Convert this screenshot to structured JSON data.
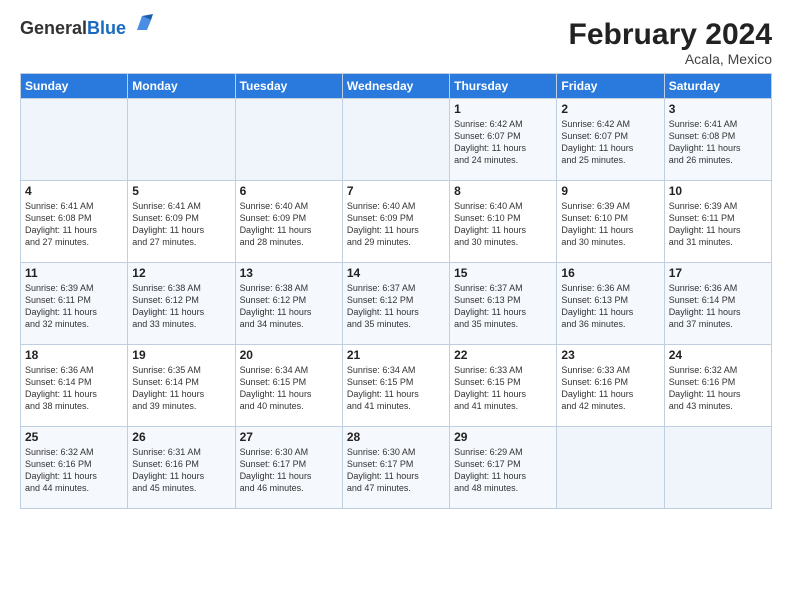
{
  "logo": {
    "general": "General",
    "blue": "Blue"
  },
  "title": "February 2024",
  "location": "Acala, Mexico",
  "days_of_week": [
    "Sunday",
    "Monday",
    "Tuesday",
    "Wednesday",
    "Thursday",
    "Friday",
    "Saturday"
  ],
  "weeks": [
    [
      {
        "day": "",
        "info": ""
      },
      {
        "day": "",
        "info": ""
      },
      {
        "day": "",
        "info": ""
      },
      {
        "day": "",
        "info": ""
      },
      {
        "day": "1",
        "info": "Sunrise: 6:42 AM\nSunset: 6:07 PM\nDaylight: 11 hours\nand 24 minutes."
      },
      {
        "day": "2",
        "info": "Sunrise: 6:42 AM\nSunset: 6:07 PM\nDaylight: 11 hours\nand 25 minutes."
      },
      {
        "day": "3",
        "info": "Sunrise: 6:41 AM\nSunset: 6:08 PM\nDaylight: 11 hours\nand 26 minutes."
      }
    ],
    [
      {
        "day": "4",
        "info": "Sunrise: 6:41 AM\nSunset: 6:08 PM\nDaylight: 11 hours\nand 27 minutes."
      },
      {
        "day": "5",
        "info": "Sunrise: 6:41 AM\nSunset: 6:09 PM\nDaylight: 11 hours\nand 27 minutes."
      },
      {
        "day": "6",
        "info": "Sunrise: 6:40 AM\nSunset: 6:09 PM\nDaylight: 11 hours\nand 28 minutes."
      },
      {
        "day": "7",
        "info": "Sunrise: 6:40 AM\nSunset: 6:09 PM\nDaylight: 11 hours\nand 29 minutes."
      },
      {
        "day": "8",
        "info": "Sunrise: 6:40 AM\nSunset: 6:10 PM\nDaylight: 11 hours\nand 30 minutes."
      },
      {
        "day": "9",
        "info": "Sunrise: 6:39 AM\nSunset: 6:10 PM\nDaylight: 11 hours\nand 30 minutes."
      },
      {
        "day": "10",
        "info": "Sunrise: 6:39 AM\nSunset: 6:11 PM\nDaylight: 11 hours\nand 31 minutes."
      }
    ],
    [
      {
        "day": "11",
        "info": "Sunrise: 6:39 AM\nSunset: 6:11 PM\nDaylight: 11 hours\nand 32 minutes."
      },
      {
        "day": "12",
        "info": "Sunrise: 6:38 AM\nSunset: 6:12 PM\nDaylight: 11 hours\nand 33 minutes."
      },
      {
        "day": "13",
        "info": "Sunrise: 6:38 AM\nSunset: 6:12 PM\nDaylight: 11 hours\nand 34 minutes."
      },
      {
        "day": "14",
        "info": "Sunrise: 6:37 AM\nSunset: 6:12 PM\nDaylight: 11 hours\nand 35 minutes."
      },
      {
        "day": "15",
        "info": "Sunrise: 6:37 AM\nSunset: 6:13 PM\nDaylight: 11 hours\nand 35 minutes."
      },
      {
        "day": "16",
        "info": "Sunrise: 6:36 AM\nSunset: 6:13 PM\nDaylight: 11 hours\nand 36 minutes."
      },
      {
        "day": "17",
        "info": "Sunrise: 6:36 AM\nSunset: 6:14 PM\nDaylight: 11 hours\nand 37 minutes."
      }
    ],
    [
      {
        "day": "18",
        "info": "Sunrise: 6:36 AM\nSunset: 6:14 PM\nDaylight: 11 hours\nand 38 minutes."
      },
      {
        "day": "19",
        "info": "Sunrise: 6:35 AM\nSunset: 6:14 PM\nDaylight: 11 hours\nand 39 minutes."
      },
      {
        "day": "20",
        "info": "Sunrise: 6:34 AM\nSunset: 6:15 PM\nDaylight: 11 hours\nand 40 minutes."
      },
      {
        "day": "21",
        "info": "Sunrise: 6:34 AM\nSunset: 6:15 PM\nDaylight: 11 hours\nand 41 minutes."
      },
      {
        "day": "22",
        "info": "Sunrise: 6:33 AM\nSunset: 6:15 PM\nDaylight: 11 hours\nand 41 minutes."
      },
      {
        "day": "23",
        "info": "Sunrise: 6:33 AM\nSunset: 6:16 PM\nDaylight: 11 hours\nand 42 minutes."
      },
      {
        "day": "24",
        "info": "Sunrise: 6:32 AM\nSunset: 6:16 PM\nDaylight: 11 hours\nand 43 minutes."
      }
    ],
    [
      {
        "day": "25",
        "info": "Sunrise: 6:32 AM\nSunset: 6:16 PM\nDaylight: 11 hours\nand 44 minutes."
      },
      {
        "day": "26",
        "info": "Sunrise: 6:31 AM\nSunset: 6:16 PM\nDaylight: 11 hours\nand 45 minutes."
      },
      {
        "day": "27",
        "info": "Sunrise: 6:30 AM\nSunset: 6:17 PM\nDaylight: 11 hours\nand 46 minutes."
      },
      {
        "day": "28",
        "info": "Sunrise: 6:30 AM\nSunset: 6:17 PM\nDaylight: 11 hours\nand 47 minutes."
      },
      {
        "day": "29",
        "info": "Sunrise: 6:29 AM\nSunset: 6:17 PM\nDaylight: 11 hours\nand 48 minutes."
      },
      {
        "day": "",
        "info": ""
      },
      {
        "day": "",
        "info": ""
      }
    ]
  ]
}
